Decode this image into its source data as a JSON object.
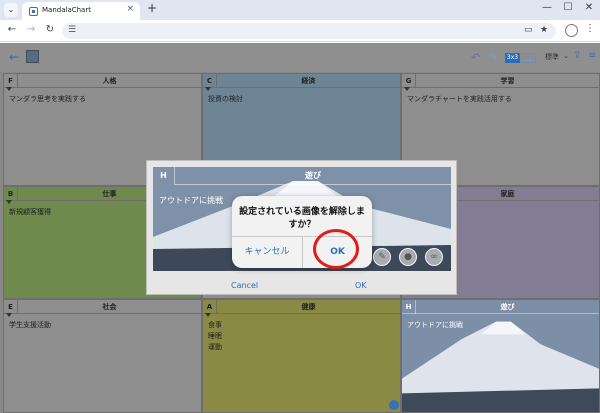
{
  "browser": {
    "tab_title": "MandalaChart",
    "tab_close": "×",
    "new_tab": "+",
    "win_min": "—",
    "win_max": "☐",
    "win_close": "✕"
  },
  "toolbar": {
    "grid_3x3": "3x3",
    "grid_9x9": "9x9",
    "mode_label": "標準"
  },
  "cells": [
    {
      "id": "F",
      "title": "人格",
      "lines": [
        "マンダラ思考を実践する"
      ],
      "color": "#8e8e8e"
    },
    {
      "id": "C",
      "title": "経済",
      "lines": [
        "投資の検討"
      ],
      "color": "#6e8596"
    },
    {
      "id": "G",
      "title": "学習",
      "lines": [
        "マンダラチャートを実践活用する"
      ],
      "color": "#8e8e8e"
    },
    {
      "id": "B",
      "title": "仕事",
      "lines": [
        "新規顧客獲得"
      ],
      "color": "#6f8a4c"
    },
    {
      "id": "H",
      "title": "",
      "lines": [],
      "color": "#8e8e8e"
    },
    {
      "id": "D",
      "title": "家庭",
      "lines": [],
      "color": "#847c93"
    },
    {
      "id": "E",
      "title": "社会",
      "lines": [
        "学生支援活動"
      ],
      "color": "#8e8e8e"
    },
    {
      "id": "A",
      "title": "健康",
      "lines": [
        "食事",
        "睡眠",
        "運動"
      ],
      "color": "#8a8a45"
    },
    {
      "id": "H",
      "title": "遊び",
      "lines": [
        "アウトドアに挑戦"
      ],
      "color": "#8e8e8e"
    }
  ],
  "editor": {
    "letter": "H",
    "title": "遊び",
    "body": "アウトドアに挑戦",
    "cancel_label": "Cancel",
    "ok_label": "OK"
  },
  "alert": {
    "message": "設定されている画像を解除しますか？",
    "cancel_label": "キャンセル",
    "ok_label": "OK"
  },
  "colors": {
    "accent": "#2b6fb8",
    "highlight": "#e21b1b"
  }
}
